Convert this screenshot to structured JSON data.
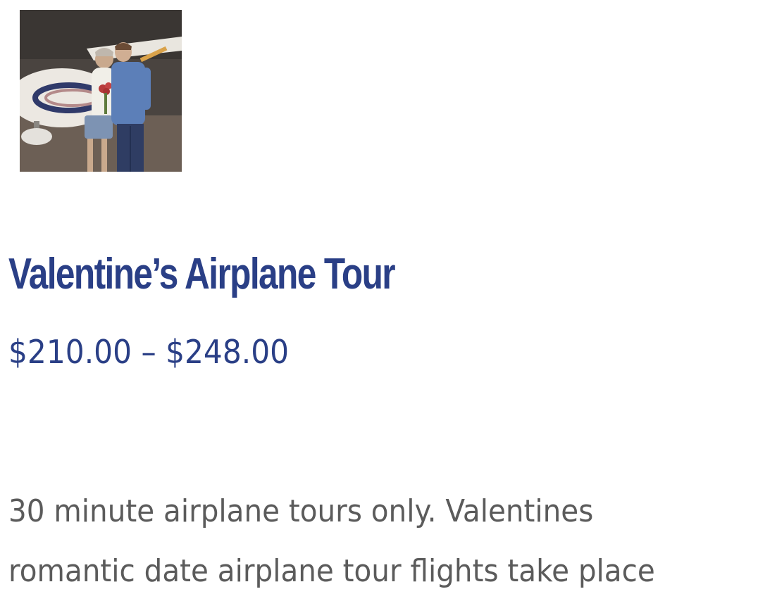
{
  "product": {
    "image_alt": "Couple standing in front of airplane",
    "title": "Valentine’s Airplane Tour",
    "price_range": "$210.00 – $248.00",
    "description_lines": [
      "30 minute airplane tours only. Valentines",
      "romantic date airplane tour flights take place"
    ]
  },
  "colors": {
    "title": "#2a3f86",
    "price": "#2a3f86",
    "text": "#5b5b5b",
    "background": "#ffffff"
  }
}
